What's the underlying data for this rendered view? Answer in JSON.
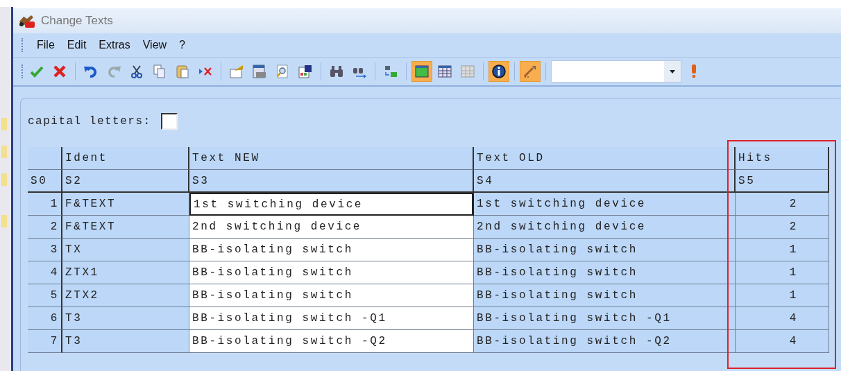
{
  "window": {
    "title": "Change Texts"
  },
  "menu": [
    {
      "label": "File"
    },
    {
      "label": "Edit"
    },
    {
      "label": "Extras"
    },
    {
      "label": "View"
    },
    {
      "label": "?"
    }
  ],
  "toolbar": {
    "groups": [
      [
        {
          "kind": "check",
          "on": false
        },
        {
          "kind": "cross",
          "on": false
        }
      ],
      [
        {
          "kind": "undo",
          "on": false
        },
        {
          "kind": "redo",
          "on": false
        },
        {
          "kind": "cut",
          "on": false
        },
        {
          "kind": "copy",
          "on": false
        },
        {
          "kind": "paste",
          "on": false
        },
        {
          "kind": "delete",
          "on": false
        }
      ],
      [
        {
          "kind": "properties",
          "on": false
        },
        {
          "kind": "preview",
          "on": false
        },
        {
          "kind": "magnifier",
          "on": false
        },
        {
          "kind": "save",
          "on": false
        }
      ],
      [
        {
          "kind": "binoculars",
          "on": false
        },
        {
          "kind": "find-next",
          "on": false
        }
      ],
      [
        {
          "kind": "replace",
          "on": false
        }
      ],
      [
        {
          "kind": "grid-green",
          "on": true
        },
        {
          "kind": "grid-blue",
          "on": false
        },
        {
          "kind": "grid-grey",
          "on": false
        }
      ],
      [
        {
          "kind": "info",
          "on": true
        }
      ],
      [
        {
          "kind": "wand",
          "on": true
        }
      ]
    ]
  },
  "capital_letters": {
    "label": "capital letters:",
    "checked": false
  },
  "table": {
    "columns": [
      {
        "label": "Ident",
        "highlighted": false
      },
      {
        "label": "Text NEW",
        "highlighted": false
      },
      {
        "label": "Text OLD",
        "highlighted": false
      },
      {
        "label": "Hits",
        "highlighted": true
      }
    ],
    "sort_row": [
      "S0",
      "S2",
      "S3",
      "S4",
      "S5"
    ],
    "rows": [
      {
        "number": "1",
        "ident": "F&TEXT",
        "text_new": "1st switching device",
        "text_old": "1st switching device",
        "hits": "2",
        "focused": true
      },
      {
        "number": "2",
        "ident": "F&TEXT",
        "text_new": "2nd switching device",
        "text_old": "2nd switching device",
        "hits": "2",
        "focused": false
      },
      {
        "number": "3",
        "ident": "TX",
        "text_new": "BB-isolating switch",
        "text_old": "BB-isolating switch",
        "hits": "1",
        "focused": false
      },
      {
        "number": "4",
        "ident": "ZTX1",
        "text_new": "BB-isolating switch",
        "text_old": "BB-isolating switch",
        "hits": "1",
        "focused": false
      },
      {
        "number": "5",
        "ident": "ZTX2",
        "text_new": "BB-isolating switch",
        "text_old": "BB-isolating switch",
        "hits": "1",
        "focused": false
      },
      {
        "number": "6",
        "ident": "T3",
        "text_new": "BB-isolating switch -Q1",
        "text_old": "BB-isolating switch -Q1",
        "hits": "4",
        "focused": false
      },
      {
        "number": "7",
        "ident": "T3",
        "text_new": "BB-isolating switch -Q2",
        "text_old": "BB-isolating switch -Q2",
        "hits": "4",
        "focused": false
      }
    ]
  }
}
